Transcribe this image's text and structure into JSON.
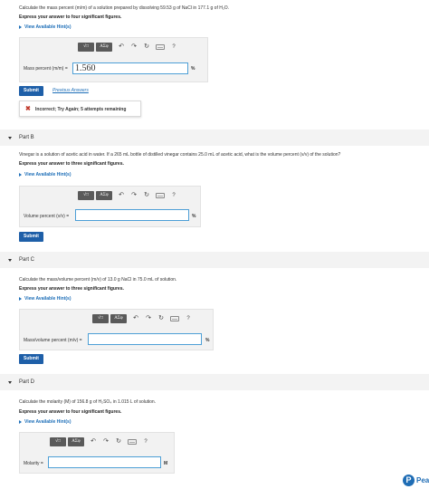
{
  "partA": {
    "question": "Calculate the mass percent (m/m) of a solution prepared by dissolving 59.53 g of NaCl in 177.1 g of H₂O.",
    "instruction": "Express your answer to four significant figures.",
    "hints": "View Available Hint(s)",
    "label": "Mass percent (m/m) =",
    "value": "1.560",
    "unit": "%",
    "submit": "Submit",
    "previous": "Previous Answers",
    "feedback": "Incorrect; Try Again; 5 attempts remaining",
    "feedback_icon": "✖"
  },
  "toolbar": {
    "templates": "√□",
    "symbols": "AΣφ",
    "undo": "↶",
    "redo": "↷",
    "reset": "↻",
    "help": "?"
  },
  "partB": {
    "title": "Part B",
    "question": "Vinegar is a solution of acetic acid in water. If a 265 mL bottle of distilled vinegar contains 25.0 mL of acetic acid, what is the volume percent (v/v) of the solution?",
    "instruction": "Express your answer to three significant figures.",
    "hints": "View Available Hint(s)",
    "label": "Volume percent (v/v) =",
    "value": "",
    "unit": "%",
    "submit": "Submit"
  },
  "partC": {
    "title": "Part C",
    "question": "Calculate the mass/volume percent (m/v) of 13.0 g NaCl in 75.0 mL of solution.",
    "instruction": "Express your answer to three significant figures.",
    "hints": "View Available Hint(s)",
    "label": "Mass/volume percent (m/v) =",
    "value": "",
    "unit": "%",
    "submit": "Submit"
  },
  "partD": {
    "title": "Part D",
    "question": "Calculate the molarity (M) of 156.8 g of H₂SO₄ in 1.015 L of solution.",
    "instruction": "Express your answer to four significant figures.",
    "hints": "View Available Hint(s)",
    "label": "Molarity =",
    "value": "",
    "unit": "M"
  },
  "brand": {
    "logo_letter": "P",
    "name": "Pear"
  },
  "colors": {
    "primary": "#1e5fa8",
    "link": "#1e6fb8",
    "error": "#c0392b",
    "input_border": "#4d9fd6"
  }
}
